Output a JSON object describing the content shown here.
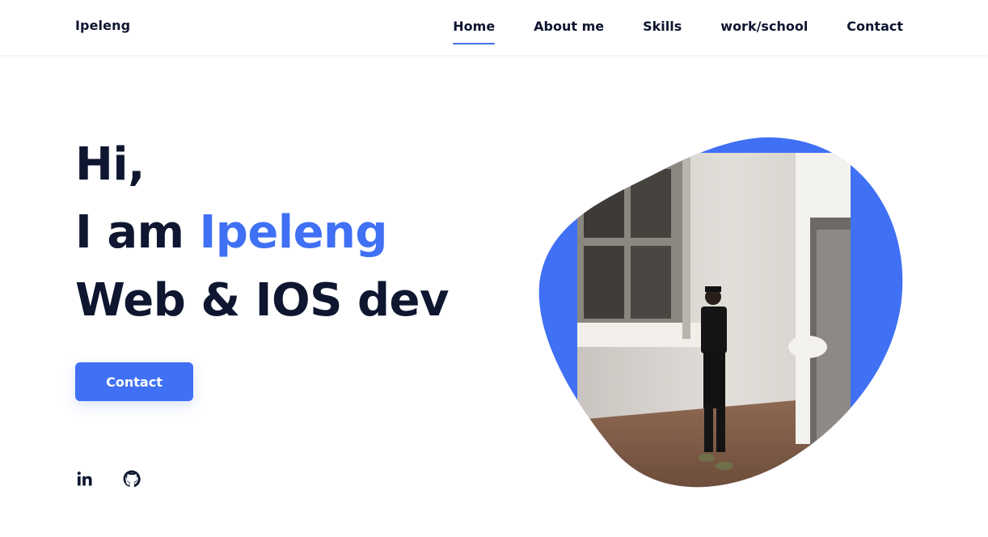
{
  "header": {
    "logo": "Ipeleng",
    "nav": [
      {
        "label": "Home",
        "active": true
      },
      {
        "label": "About me",
        "active": false
      },
      {
        "label": "Skills",
        "active": false
      },
      {
        "label": "work/school",
        "active": false
      },
      {
        "label": "Contact",
        "active": false
      }
    ]
  },
  "hero": {
    "line1": "Hi,",
    "line2_prefix": "I am ",
    "line2_name": "Ipeleng",
    "line3": "Web & IOS dev",
    "cta_label": "Contact"
  },
  "social": [
    {
      "icon": "linkedin-icon"
    },
    {
      "icon": "github-icon"
    }
  ],
  "colors": {
    "accent": "#4070f4",
    "text": "#0e1630",
    "background": "#ffffff"
  }
}
